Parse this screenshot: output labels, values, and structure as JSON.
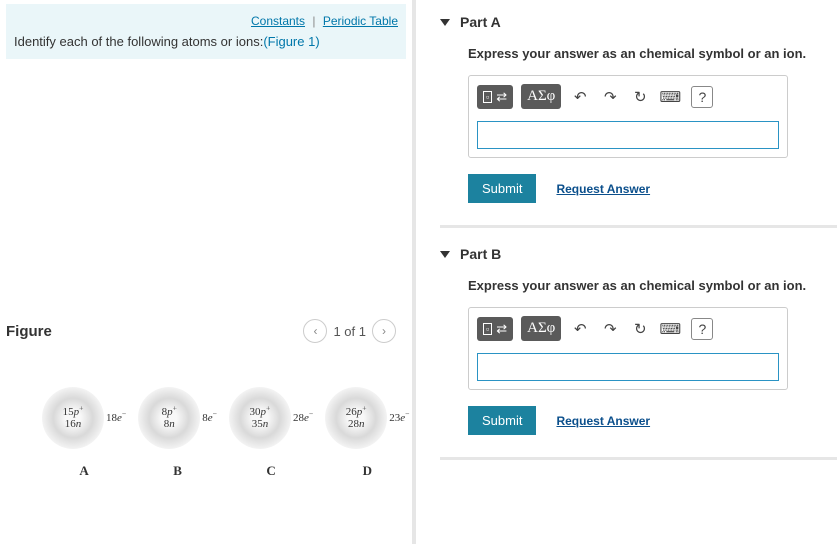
{
  "links": {
    "constants": "Constants",
    "sep": "|",
    "periodic": "Periodic Table"
  },
  "prompt": {
    "text": "Identify each of the following atoms or ions:",
    "figref": "(Figure 1)"
  },
  "figure": {
    "title": "Figure",
    "pager": {
      "text": "1 of 1"
    },
    "atoms": [
      {
        "p": "15",
        "n": "16",
        "e": "18",
        "label": "A"
      },
      {
        "p": "8",
        "n": "8",
        "e": "8",
        "label": "B"
      },
      {
        "p": "30",
        "n": "35",
        "e": "28",
        "label": "C"
      },
      {
        "p": "26",
        "n": "28",
        "e": "23",
        "label": "D"
      }
    ]
  },
  "parts": {
    "a": {
      "title": "Part A",
      "prompt": "Express your answer as an chemical symbol or an ion."
    },
    "b": {
      "title": "Part B",
      "prompt": "Express your answer as an chemical symbol or an ion."
    }
  },
  "toolbar": {
    "greek": "ΑΣφ",
    "undo": "↶",
    "redo": "↷",
    "reset": "↻",
    "keyboard": "⌨",
    "help": "?"
  },
  "buttons": {
    "submit": "Submit",
    "request": "Request Answer"
  }
}
